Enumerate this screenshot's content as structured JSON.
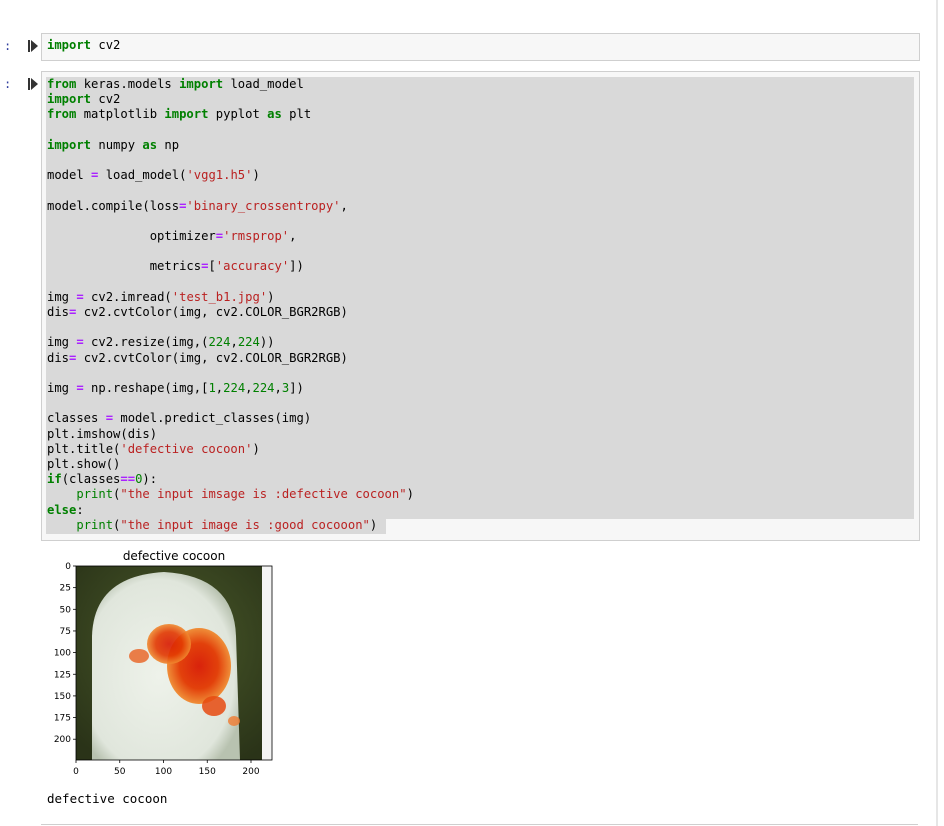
{
  "cell1": {
    "prompt": ":",
    "code": "import cv2"
  },
  "cell2": {
    "prompt": ":"
  },
  "output": {
    "plot_title": "defective cocoon",
    "y_ticks": [
      "0",
      "25",
      "50",
      "75",
      "100",
      "125",
      "150",
      "175",
      "200"
    ],
    "x_ticks": [
      "0",
      "50",
      "100",
      "150",
      "200"
    ],
    "printed": "defective cocoon"
  },
  "chart_data": {
    "type": "image",
    "title": "defective cocoon",
    "xlabel": "",
    "ylabel": "",
    "xlim": [
      0,
      224
    ],
    "ylim": [
      224,
      0
    ],
    "x_ticks": [
      0,
      50,
      100,
      150,
      200
    ],
    "y_ticks": [
      0,
      25,
      50,
      75,
      100,
      125,
      150,
      175,
      200
    ]
  },
  "colors": {
    "keyword": "#008000",
    "operator": "#aa22ff",
    "string": "#ba2121",
    "prompt": "#303f9f",
    "selection": "#d9d9d9"
  }
}
